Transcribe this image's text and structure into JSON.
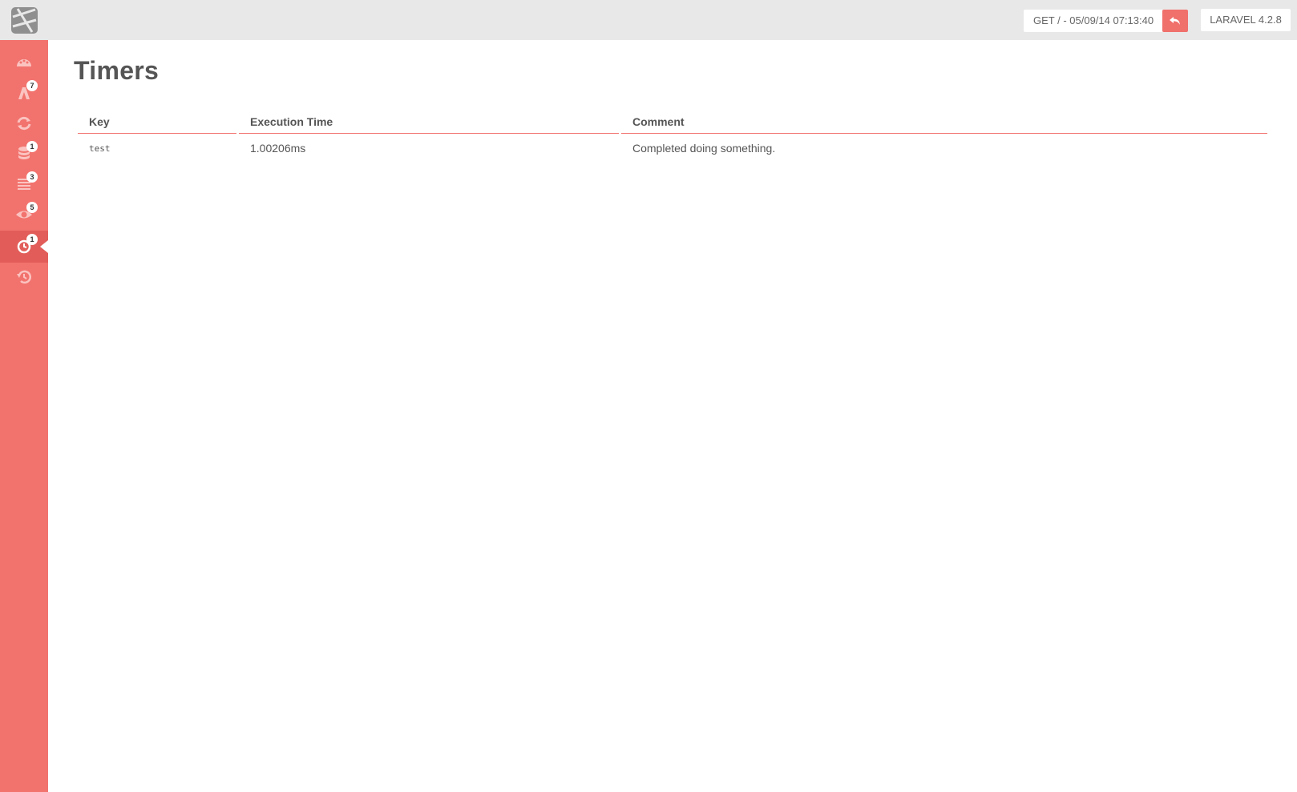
{
  "topbar": {
    "request_label": "GET / - 05/09/14 07:13:40",
    "version_label": "LARAVEL 4.2.8"
  },
  "sidebar": {
    "items": [
      {
        "icon": "dashboard-icon",
        "badge": null
      },
      {
        "icon": "routes-icon",
        "badge": "7"
      },
      {
        "icon": "refresh-icon",
        "badge": null
      },
      {
        "icon": "database-icon",
        "badge": "1"
      },
      {
        "icon": "log-icon",
        "badge": "3"
      },
      {
        "icon": "eye-icon",
        "badge": "5"
      },
      {
        "icon": "clock-icon",
        "badge": "1",
        "active": true
      },
      {
        "icon": "history-icon",
        "badge": null
      }
    ]
  },
  "main": {
    "title": "Timers",
    "columns": [
      "Key",
      "Execution Time",
      "Comment"
    ],
    "rows": [
      {
        "key": "test",
        "execution_time": "1.00206ms",
        "comment": "Completed doing something."
      }
    ]
  },
  "colors": {
    "accent": "#f2736e",
    "accent_dark": "#e25d59",
    "topbar": "#e8e8e8"
  }
}
